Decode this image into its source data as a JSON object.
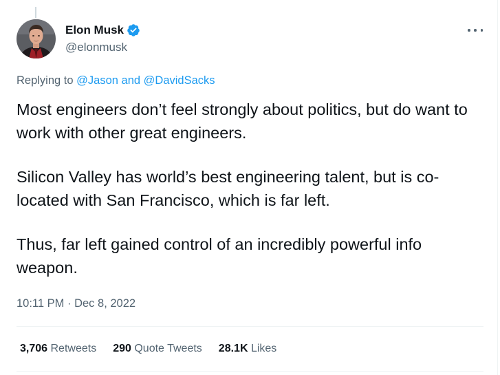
{
  "author": {
    "display_name": "Elon Musk",
    "handle": "@elonmusk",
    "verified": true
  },
  "reply_context": {
    "prefix": "Replying to",
    "mention1": "@Jason",
    "conjunction": "and",
    "mention2": "@DavidSacks"
  },
  "tweet": {
    "paragraphs": [
      "Most engineers don’t feel strongly about politics, but do want to work with other great engineers.",
      "Silicon Valley has world’s best engineering talent, but is co-located with San Francisco, which is far left.",
      "Thus, far left gained control of an incredibly powerful info weapon."
    ],
    "time": "10:11 PM",
    "separator": "·",
    "date": "Dec 8, 2022"
  },
  "stats": {
    "retweets": {
      "count": "3,706",
      "label": "Retweets"
    },
    "quote_tweets": {
      "count": "290",
      "label": "Quote Tweets"
    },
    "likes": {
      "count": "28.1K",
      "label": "Likes"
    }
  },
  "colors": {
    "accent": "#1d9bf0",
    "text_primary": "#0f1419",
    "text_secondary": "#536471",
    "divider": "#eff3f4"
  },
  "icons": {
    "verified": "verified-badge-icon",
    "more": "more-options-icon"
  }
}
